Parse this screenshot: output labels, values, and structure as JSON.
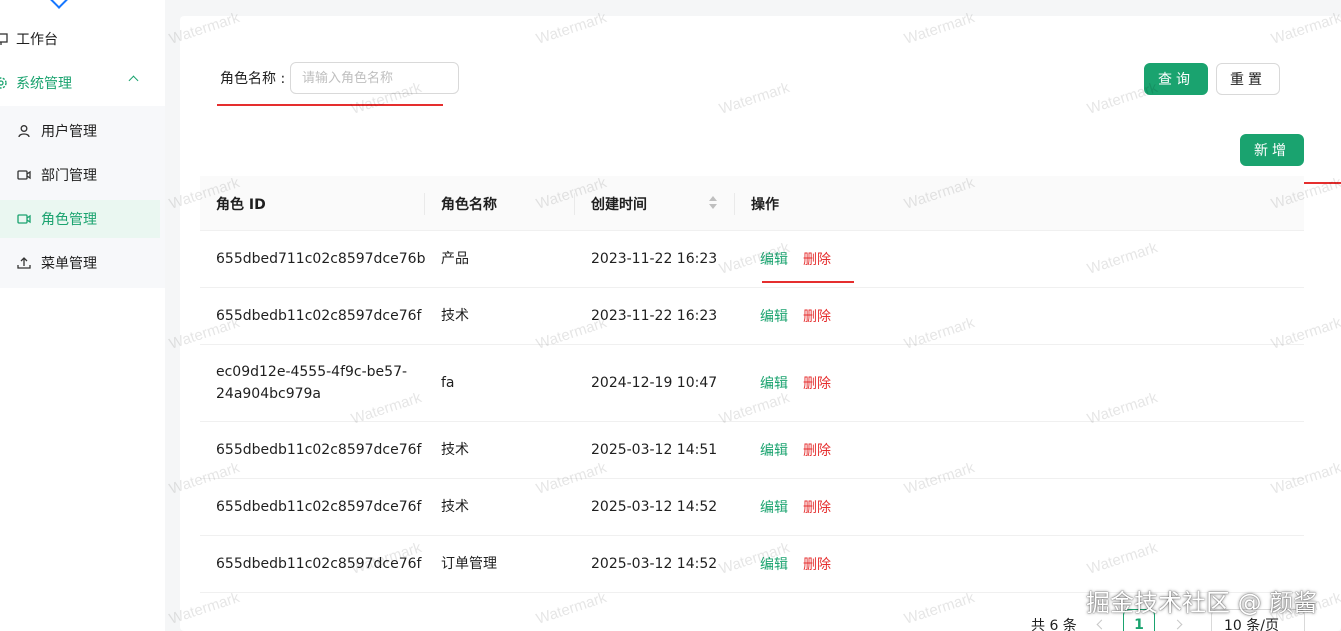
{
  "sidebar": {
    "workbench": "工作台",
    "system_group": "系统管理",
    "items": [
      {
        "label": "用户管理"
      },
      {
        "label": "部门管理"
      },
      {
        "label": "角色管理"
      },
      {
        "label": "菜单管理"
      }
    ]
  },
  "search": {
    "label": "角色名称 :",
    "placeholder": "请输入角色名称",
    "query_button": "查询",
    "reset_button": "重置"
  },
  "add_button": "新增",
  "table": {
    "columns": [
      "角色 ID",
      "角色名称",
      "创建时间",
      "操作"
    ],
    "rows": [
      {
        "id": "655dbed711c02c8597dce76b",
        "name": "产品",
        "created": "2023-11-22 16:23"
      },
      {
        "id": "655dbedb11c02c8597dce76f",
        "name": "技术",
        "created": "2023-11-22 16:23"
      },
      {
        "id": "ec09d12e-4555-4f9c-be57-",
        "id2": "24a904bc979a",
        "name": "fa",
        "created": "2024-12-19 10:47"
      },
      {
        "id": "655dbedb11c02c8597dce76f",
        "name": "技术",
        "created": "2025-03-12 14:51"
      },
      {
        "id": "655dbedb11c02c8597dce76f",
        "name": "技术",
        "created": "2025-03-12 14:52"
      },
      {
        "id": "655dbedb11c02c8597dce76f",
        "name": "订单管理",
        "created": "2025-03-12 14:52"
      }
    ],
    "edit_label": "编辑",
    "delete_label": "删除"
  },
  "pagination": {
    "total": "共 6 条",
    "current": "1",
    "page_size": "10 条/页"
  },
  "watermark": "Watermark",
  "credit": "掘金技术社区 @ 颜酱",
  "colors": {
    "primary": "#1aa36f",
    "danger": "#e52e2e",
    "annotation": "#e52e2e"
  }
}
